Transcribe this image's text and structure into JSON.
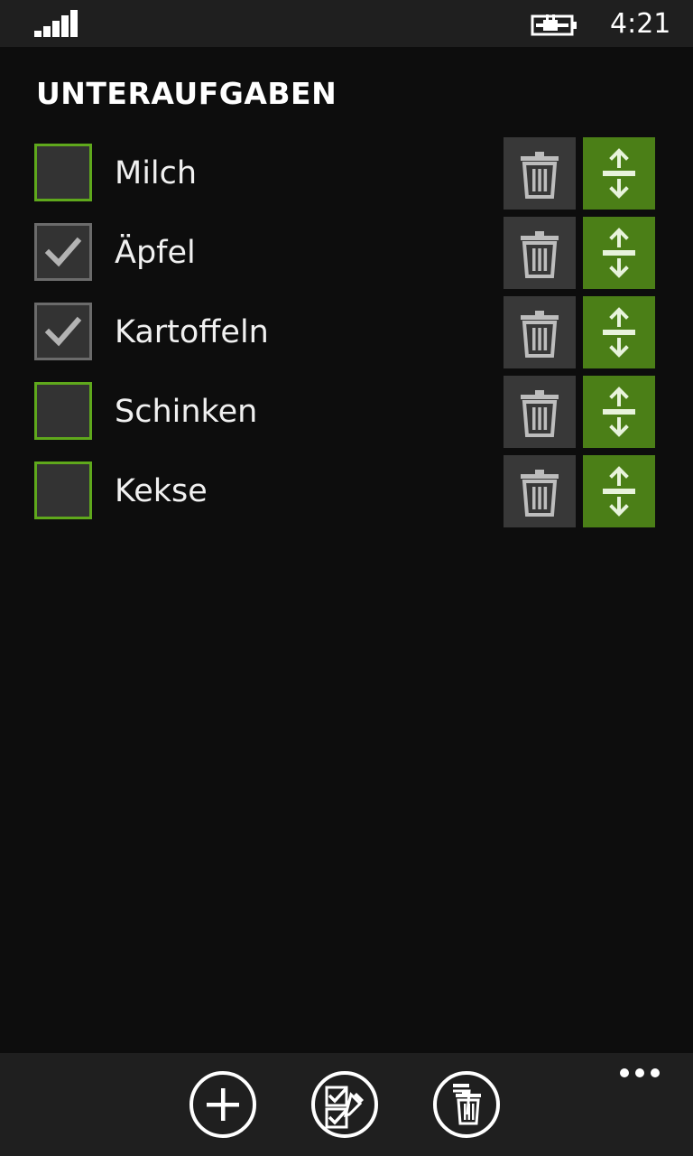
{
  "status_bar": {
    "time": "4:21",
    "signal_icon": "signal-strength-icon",
    "battery_icon": "battery-charging-icon"
  },
  "page": {
    "title": "UNTERAUFGABEN"
  },
  "tasks": [
    {
      "label": "Milch",
      "checked": false
    },
    {
      "label": "Äpfel",
      "checked": true
    },
    {
      "label": "Kartoffeln",
      "checked": true
    },
    {
      "label": "Schinken",
      "checked": false
    },
    {
      "label": "Kekse",
      "checked": false
    }
  ],
  "row_actions": {
    "delete_icon": "trash-icon",
    "move_icon": "reorder-icon"
  },
  "app_bar": {
    "buttons": [
      {
        "icon": "add-icon"
      },
      {
        "icon": "check-all-edit-icon"
      },
      {
        "icon": "delete-all-icon"
      }
    ],
    "more_icon": "ellipsis-icon"
  },
  "colors": {
    "accent": "#4b7f17",
    "checkbox_border_unchecked": "#5fa81c",
    "background": "#0d0d0d",
    "bar_background": "#1f1f1f"
  }
}
